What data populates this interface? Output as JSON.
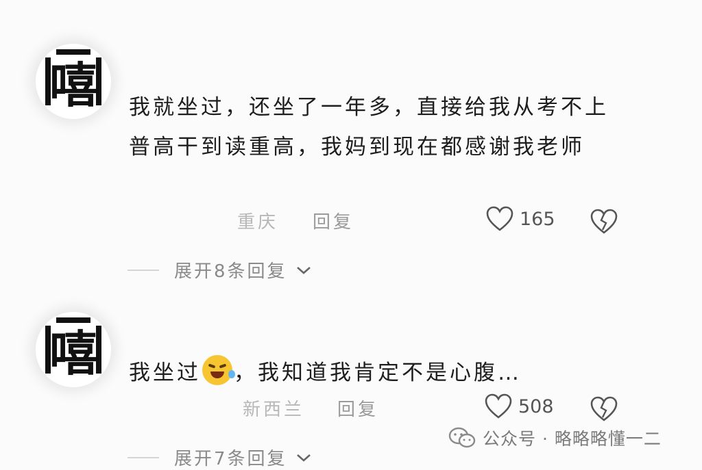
{
  "comments": [
    {
      "avatar_char": "嘻",
      "text": "我就坐过，还坐了一年多，直接给我从考不上普高干到读重高，我妈到现在都感谢我老师",
      "location": "重庆",
      "reply_label": "回复",
      "likes": "165",
      "expand_label": "展开8条回复"
    },
    {
      "avatar_char": "嘻",
      "text_before_emoji": "我坐过",
      "emoji_icon": "laughing-tears-emoji",
      "text_after_emoji": "，我知道我肯定不是心腹…",
      "location": "新西兰",
      "reply_label": "回复",
      "likes": "508",
      "expand_label": "展开7条回复"
    }
  ],
  "watermark": {
    "icon": "wechat-icon",
    "text": "公众号 · 略略略懂一二"
  },
  "colors": {
    "background": "#fbfbfb",
    "text": "#1e1e1e",
    "muted": "#b7b7b7",
    "emoji": "#f7c531"
  }
}
